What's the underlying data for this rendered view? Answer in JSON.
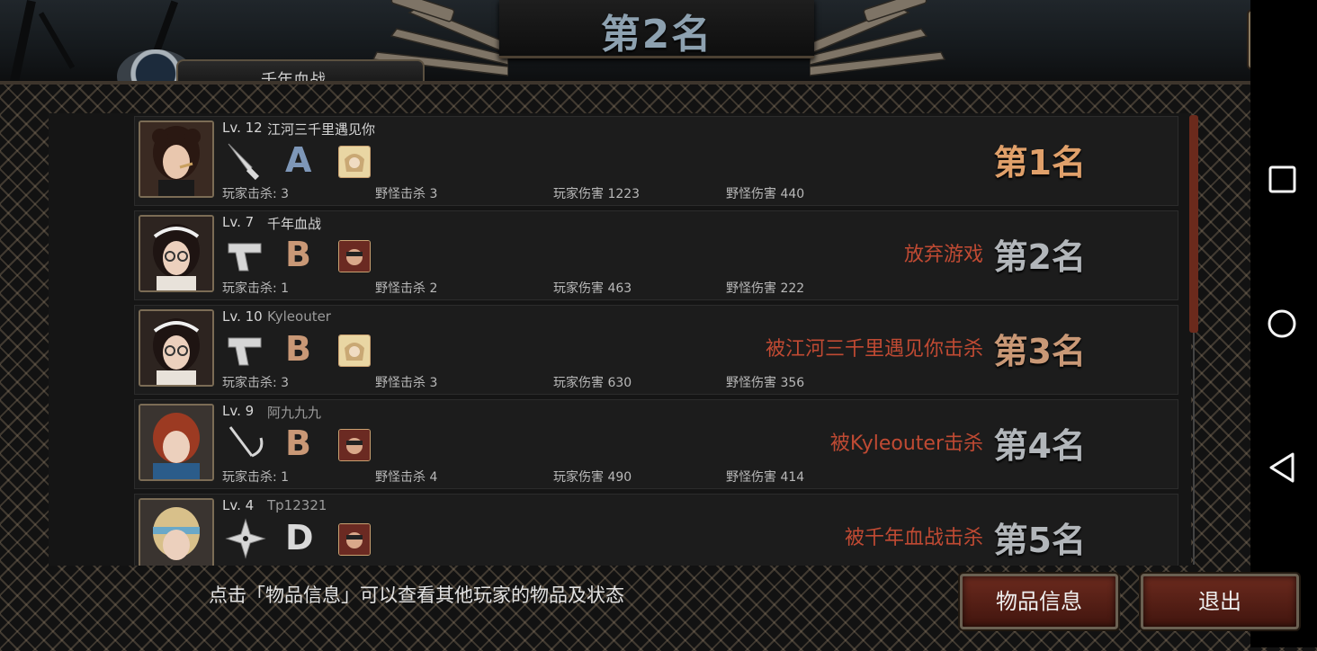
{
  "header": {
    "title": "第2名",
    "player_tab": "千年血战"
  },
  "rows": [
    {
      "level": "Lv. 12",
      "name": "江河三千里遇见你",
      "grade": "A",
      "player_kills": "玩家击杀: 3",
      "monster_kills": "野怪击杀 3",
      "player_damage": "玩家伤害 1223",
      "monster_damage": "野怪伤害 440",
      "status": "",
      "rank": "第1名"
    },
    {
      "level": "Lv. 7",
      "name": "千年血战",
      "grade": "B",
      "player_kills": "玩家击杀: 1",
      "monster_kills": "野怪击杀 2",
      "player_damage": "玩家伤害 463",
      "monster_damage": "野怪伤害 222",
      "status": "放弃游戏",
      "rank": "第2名"
    },
    {
      "level": "Lv. 10",
      "name": "Kyleouter",
      "grade": "B",
      "player_kills": "玩家击杀: 3",
      "monster_kills": "野怪击杀 3",
      "player_damage": "玩家伤害 630",
      "monster_damage": "野怪伤害 356",
      "status": "被江河三千里遇见你击杀",
      "rank": "第3名"
    },
    {
      "level": "Lv. 9",
      "name": "阿九九九",
      "grade": "B",
      "player_kills": "玩家击杀: 1",
      "monster_kills": "野怪击杀 4",
      "player_damage": "玩家伤害 490",
      "monster_damage": "野怪伤害 414",
      "status": "被Kyleouter击杀",
      "rank": "第4名"
    },
    {
      "level": "Lv. 4",
      "name": "Tp12321",
      "grade": "D",
      "status": "被千年血战击杀",
      "rank": "第5名"
    }
  ],
  "footer": {
    "hint": "点击「物品信息」可以查看其他玩家的物品及状态",
    "item_info_button": "物品信息",
    "exit_button": "退出"
  },
  "colors": {
    "status_red": "#c04a33",
    "rank_gold": "#e0a06a",
    "rank_silver": "#b2b6ba",
    "button_red": "#6b2a1e"
  },
  "icons": [
    "share-icon",
    "knife-icon",
    "pistol-icon",
    "sickle-icon",
    "shuriken-icon",
    "square-nav-icon",
    "circle-nav-icon",
    "back-triangle-icon"
  ]
}
